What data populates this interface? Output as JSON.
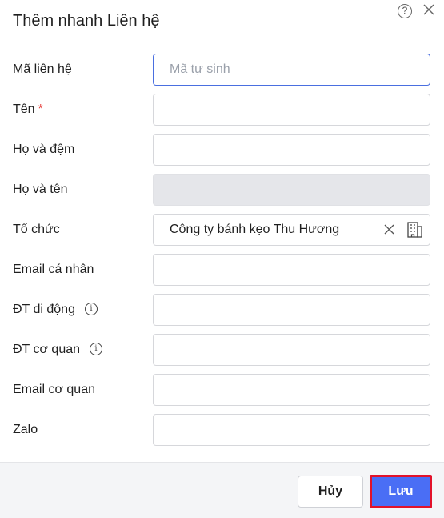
{
  "dialog": {
    "title": "Thêm nhanh Liên hệ"
  },
  "fields": {
    "contact_code": {
      "label": "Mã liên hệ",
      "placeholder": "Mã tự sinh",
      "value": ""
    },
    "first_name": {
      "label": "Tên",
      "required_mark": "*",
      "value": ""
    },
    "middle_name": {
      "label": "Họ và đệm",
      "value": ""
    },
    "full_name": {
      "label": "Họ và tên",
      "value": ""
    },
    "organization": {
      "label": "Tổ chức",
      "value": "Công ty bánh kẹo Thu Hương"
    },
    "personal_email": {
      "label": "Email cá nhân",
      "value": ""
    },
    "mobile_phone": {
      "label": "ĐT di động",
      "value": ""
    },
    "office_phone": {
      "label": "ĐT cơ quan",
      "value": ""
    },
    "work_email": {
      "label": "Email cơ quan",
      "value": ""
    },
    "zalo": {
      "label": "Zalo",
      "value": ""
    }
  },
  "footer": {
    "cancel_label": "Hủy",
    "save_label": "Lưu"
  },
  "icons": {
    "help": "help-icon",
    "close": "close-icon",
    "info": "info-icon",
    "clear": "clear-icon",
    "building": "building-icon"
  },
  "colors": {
    "primary": "#4a6ef5",
    "focus_border": "#4a6fe0",
    "required": "#e53935",
    "highlight_border": "#e2122a",
    "disabled_bg": "#e5e6ea"
  }
}
